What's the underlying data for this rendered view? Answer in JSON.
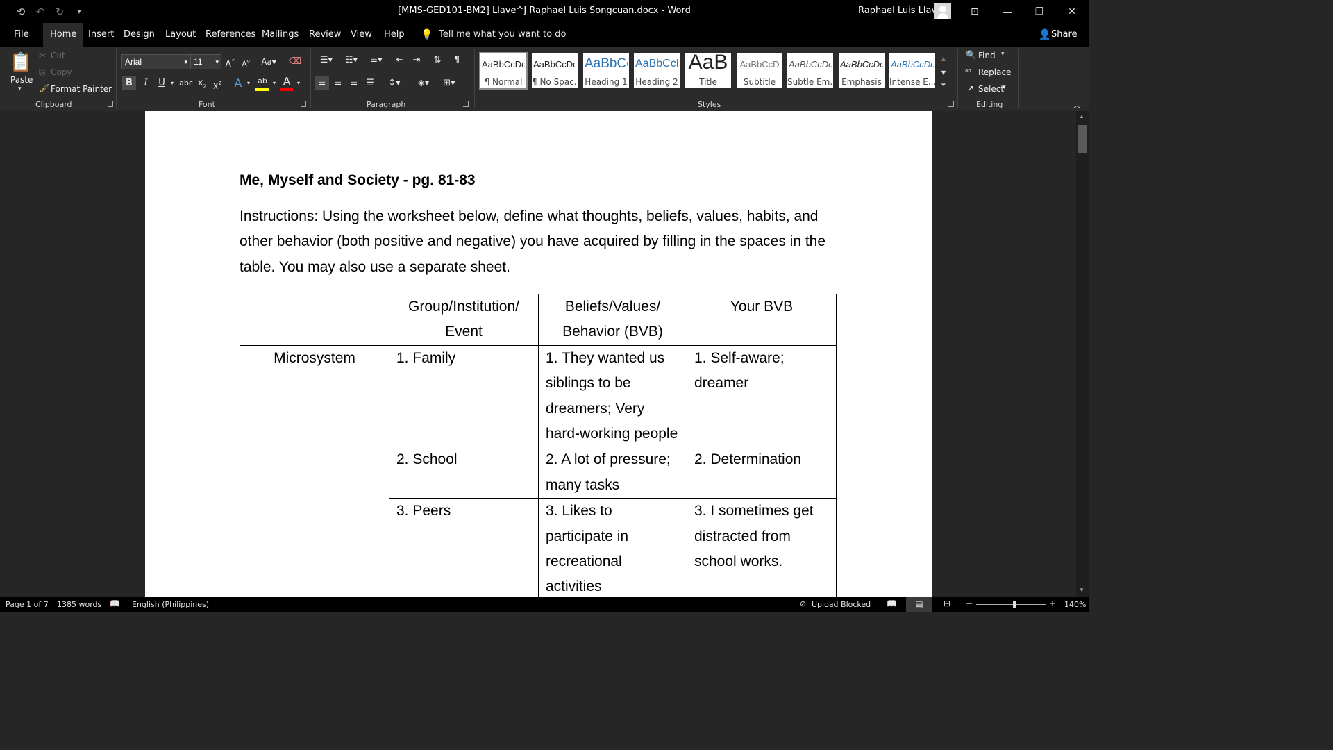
{
  "window": {
    "title": "[MMS-GED101-BM2] Llave^J Raphael Luis Songcuan.docx  -  Word",
    "user": "Raphael Luis Llave"
  },
  "menu": {
    "tabs": [
      "File",
      "Home",
      "Insert",
      "Design",
      "Layout",
      "References",
      "Mailings",
      "Review",
      "View",
      "Help"
    ],
    "active": "Home",
    "tell_me": "Tell me what you want to do",
    "share": "Share"
  },
  "ribbon": {
    "clipboard": {
      "label": "Clipboard",
      "paste": "Paste",
      "cut": "Cut",
      "copy": "Copy",
      "format_painter": "Format Painter"
    },
    "font": {
      "label": "Font",
      "family": "Arial",
      "size": "11"
    },
    "paragraph": {
      "label": "Paragraph"
    },
    "styles": {
      "label": "Styles",
      "items": [
        {
          "sample": "AaBbCcDd",
          "name": "¶ Normal"
        },
        {
          "sample": "AaBbCcDd",
          "name": "¶ No Spac..."
        },
        {
          "sample": "AaBbCc",
          "name": "Heading 1"
        },
        {
          "sample": "AaBbCcD",
          "name": "Heading 2"
        },
        {
          "sample": "AaB",
          "name": "Title"
        },
        {
          "sample": "AaBbCcD",
          "name": "Subtitle"
        },
        {
          "sample": "AaBbCcDd",
          "name": "Subtle Em..."
        },
        {
          "sample": "AaBbCcDd",
          "name": "Emphasis"
        },
        {
          "sample": "AaBbCcDd",
          "name": "Intense E..."
        }
      ]
    },
    "editing": {
      "label": "Editing",
      "find": "Find",
      "replace": "Replace",
      "select": "Select"
    }
  },
  "document": {
    "heading": "Me, Myself and Society - pg. 81-83",
    "instructions": "Instructions: Using the worksheet below, define what thoughts, beliefs, values, habits, and other behavior (both positive and negative) you have acquired by filling in the spaces in the table. You may also use a separate sheet.",
    "table": {
      "headers": [
        "",
        "Group/Institution/\nEvent",
        "Beliefs/Values/\nBehavior (BVB)",
        "Your BVB"
      ],
      "system": "Microsystem",
      "rows": [
        {
          "group": "1. Family",
          "bvb": "1. They wanted us\nsiblings to be\ndreamers; Very\nhard-working people",
          "your_bvb": "1. Self-aware;\ndreamer"
        },
        {
          "group": "2. School",
          "bvb": "2. A lot of pressure;\nmany tasks",
          "your_bvb": "2. Determination"
        },
        {
          "group": "3. Peers",
          "bvb": "3. Likes to\nparticipate in\nrecreational\nactivities",
          "your_bvb": "3. I sometimes get\ndistracted from\nschool works."
        }
      ]
    }
  },
  "status": {
    "page": "Page 1 of 7",
    "words": "1385 words",
    "language": "English (Philippines)",
    "upload": "Upload Blocked",
    "zoom": "140%"
  }
}
